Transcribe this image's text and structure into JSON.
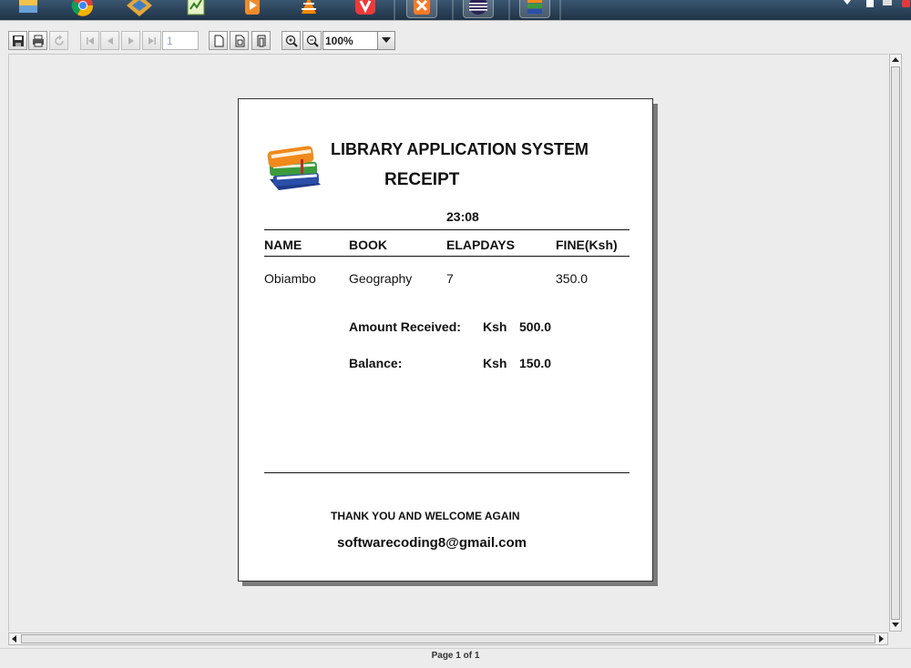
{
  "viewer": {
    "zoom": "100%",
    "page_number": "1",
    "status": "Page 1 of 1"
  },
  "receipt": {
    "title": "LIBRARY APPLICATION SYSTEM",
    "subtitle": "RECEIPT",
    "time": "23:08",
    "columns": [
      "NAME",
      "BOOK",
      "ELAPDAYS",
      "FINE(Ksh)"
    ],
    "row": [
      "Obiambo",
      "Geography",
      "7",
      "350.0"
    ],
    "amount_received_label": "Amount Received:",
    "amount_received_currency": "Ksh",
    "amount_received_value": "500.0",
    "balance_label": "Balance:",
    "balance_currency": "Ksh",
    "balance_value": "150.0",
    "thanks": "THANK YOU AND WELCOME AGAIN",
    "email": "softwarecoding8@gmail.com"
  },
  "colors": {
    "book_orange": "#f08a1c",
    "book_green": "#3c9a3c",
    "book_blue": "#2b4fa8"
  },
  "icons": [
    "save-icon",
    "print-icon",
    "reload-icon",
    "first-page-icon",
    "previous-page-icon",
    "next-page-icon",
    "last-page-icon",
    "actual-size-icon",
    "fit-page-icon",
    "fit-width-icon",
    "zoom-in-icon",
    "zoom-out-icon",
    "books-icon"
  ]
}
